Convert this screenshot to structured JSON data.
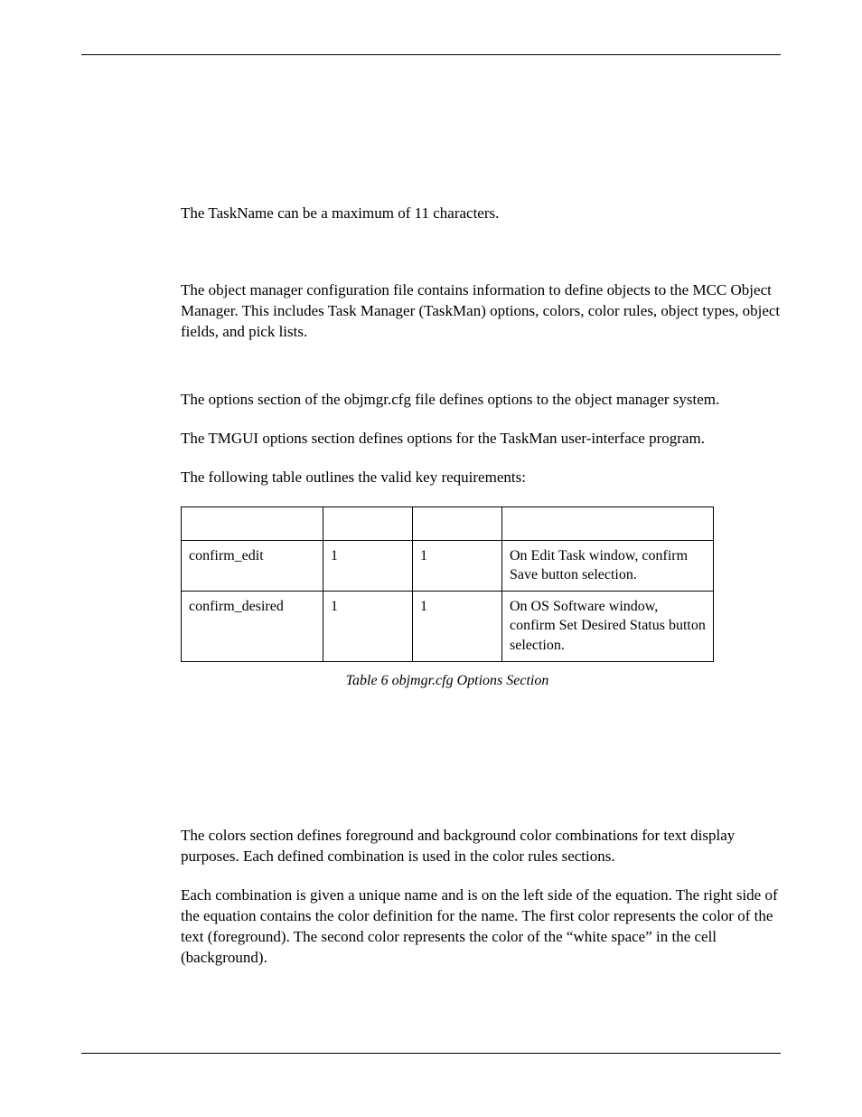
{
  "paragraphs": {
    "p1": "The TaskName can be a maximum of 11 characters.",
    "p2": "The object manager configuration file contains information to define objects to the MCC Object Manager. This includes Task Manager (TaskMan) options, colors, color rules, object types, object fields, and pick lists.",
    "p3": "The options section of the objmgr.cfg file defines options to the object manager system.",
    "p4": "The TMGUI options section defines options for the TaskMan user-interface program.",
    "p5": "The following table outlines the valid key requirements:",
    "p6": "The colors section defines foreground and background color combinations for text display purposes. Each defined combination is used in the color rules sections.",
    "p7": "Each combination is given a unique name and is on the left side of the equation. The right side of the equation contains the color definition for the name. The first color represents the color of the text (foreground). The second color represents the color of the “white space” in the cell (background)."
  },
  "table": {
    "caption": "Table 6 objmgr.cfg Options Section",
    "rows": [
      {
        "key": "confirm_edit",
        "req": "1",
        "def": "1",
        "desc": "On Edit Task window, confirm Save button selection."
      },
      {
        "key": "confirm_desired",
        "req": "1",
        "def": "1",
        "desc": "On OS Software window, confirm Set Desired Status button selection."
      }
    ]
  }
}
